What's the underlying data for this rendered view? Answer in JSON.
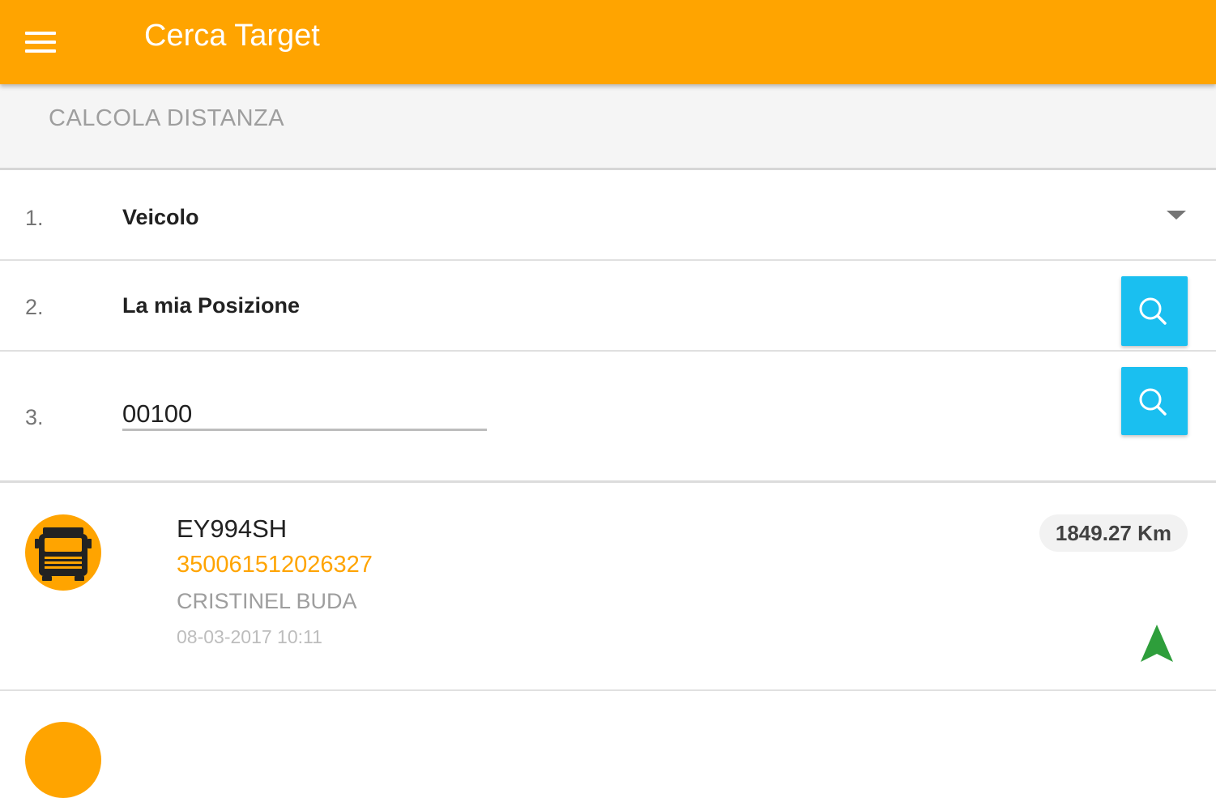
{
  "app_bar": {
    "title": "Cerca Target",
    "menu_icon": "hamburger-menu-icon",
    "color": "#FFA400"
  },
  "tab": {
    "label": "CALCOLA DISTANZA"
  },
  "form": {
    "rows": [
      {
        "number": "1.",
        "value": "Veicolo",
        "control": "dropdown"
      },
      {
        "number": "2.",
        "value": "La mia Posizione",
        "control": "search-button"
      },
      {
        "number": "3.",
        "input_value": "00100",
        "control": "search-button"
      }
    ],
    "search_button_color": "#1ABFF0"
  },
  "results": [
    {
      "icon": "truck-icon",
      "plate": "EY994SH",
      "imei": "350061512026327",
      "driver": "CRISTINEL BUDA",
      "timestamp": "08-03-2017 10:11",
      "distance": "1849.27 Km",
      "nav_icon": "navigation-arrow-icon",
      "nav_color": "#2E9E3B"
    }
  ]
}
